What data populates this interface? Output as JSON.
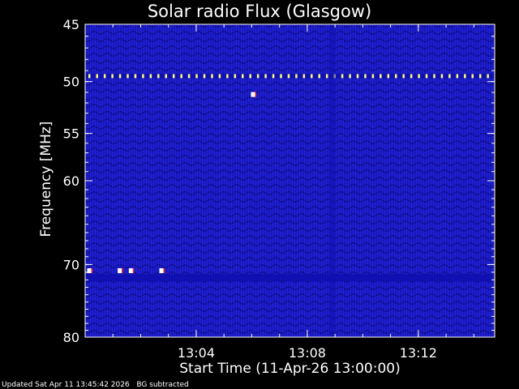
{
  "chart_data": {
    "type": "heatmap",
    "title": "Solar radio Flux (Glasgow)",
    "xlabel": "Start Time (11-Apr-26 13:00:00)",
    "ylabel": "Frequency [MHz]",
    "x_ticks": [
      "13:04",
      "13:08",
      "13:12"
    ],
    "x_tick_minutes": [
      4,
      8,
      12
    ],
    "x_range_minutes": [
      0,
      14.75
    ],
    "y_ticks": [
      45,
      50,
      55,
      60,
      70,
      80
    ],
    "y_range": [
      45,
      80
    ],
    "y_scale": "log",
    "colormap": [
      "#000033",
      "#1010b0",
      "#2a2ae8",
      "#ff2020",
      "#ffff80",
      "#ffffff"
    ],
    "features": [
      {
        "kind": "narrowband-line",
        "frequency_mhz": 49.5
      },
      {
        "kind": "dark-band",
        "frequency_mhz": 71.8
      },
      {
        "kind": "bright-dots",
        "frequency_mhz": 70.8,
        "times_minutes": [
          0.0,
          1.1,
          1.5,
          2.6
        ]
      },
      {
        "kind": "bright-dot",
        "frequency_mhz": 51.2,
        "times_minutes": [
          5.9
        ]
      },
      {
        "kind": "vertical-stripe",
        "times_minutes": [
          8.9
        ]
      }
    ]
  },
  "footer": {
    "updated": "Updated Sat Apr 11 13:45:42 2026",
    "note": "BG subtracted"
  }
}
